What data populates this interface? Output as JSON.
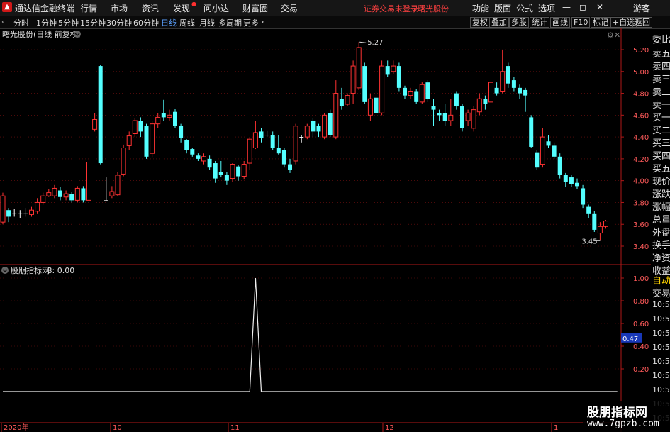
{
  "window": {
    "app_title": "通达信金融终端",
    "menus": [
      "行情",
      "市场",
      "资讯",
      "发现",
      "问小达",
      "财富圈",
      "交易"
    ],
    "notice": "证券交易未登录",
    "stock_name": "曙光股份",
    "right_menus": [
      "功能",
      "版面",
      "公式",
      "选项"
    ],
    "user": "游客"
  },
  "toolbar": {
    "periods": [
      "分时",
      "1分钟",
      "5分钟",
      "15分钟",
      "30分钟",
      "60分钟",
      "日线",
      "周线",
      "月线",
      "多周期",
      "更多"
    ],
    "active_period": "日线",
    "buttons": [
      "复权",
      "叠加",
      "多股",
      "统计",
      "画线",
      "F10",
      "标记",
      "+自选",
      "返回"
    ]
  },
  "chart": {
    "header": "曙光股份(日线 前复权)",
    "y_ticks": [
      "5.20",
      "5.00",
      "4.80",
      "4.60",
      "4.40",
      "4.20",
      "4.00",
      "3.80",
      "3.60",
      "3.40"
    ],
    "high_label": "5.27",
    "low_label": "3.45",
    "candles": [
      {
        "o": 3.62,
        "c": 3.86,
        "h": 3.89,
        "l": 3.6
      },
      {
        "o": 3.73,
        "c": 3.67,
        "h": 3.75,
        "l": 3.62
      },
      {
        "o": 3.7,
        "c": 3.7,
        "h": 3.74,
        "l": 3.67
      },
      {
        "o": 3.7,
        "c": 3.7,
        "h": 3.73,
        "l": 3.66
      },
      {
        "o": 3.7,
        "c": 3.7,
        "h": 3.75,
        "l": 3.67
      },
      {
        "o": 3.69,
        "c": 3.73,
        "h": 3.76,
        "l": 3.67
      },
      {
        "o": 3.72,
        "c": 3.8,
        "h": 3.84,
        "l": 3.7
      },
      {
        "o": 3.8,
        "c": 3.86,
        "h": 3.89,
        "l": 3.78
      },
      {
        "o": 3.86,
        "c": 3.89,
        "h": 3.92,
        "l": 3.85
      },
      {
        "o": 3.86,
        "c": 3.93,
        "h": 3.96,
        "l": 3.84
      },
      {
        "o": 3.91,
        "c": 3.85,
        "h": 3.94,
        "l": 3.82
      },
      {
        "o": 3.85,
        "c": 3.88,
        "h": 3.91,
        "l": 3.82
      },
      {
        "o": 3.88,
        "c": 3.82,
        "h": 3.9,
        "l": 3.8
      },
      {
        "o": 3.82,
        "c": 3.93,
        "h": 3.95,
        "l": 3.8
      },
      {
        "o": 3.93,
        "c": 3.82,
        "h": 3.95,
        "l": 3.8
      },
      {
        "o": 3.82,
        "c": 4.17,
        "h": 4.18,
        "l": 3.82
      },
      {
        "o": 4.47,
        "c": 4.56,
        "h": 4.62,
        "l": 4.45
      },
      {
        "o": 5.05,
        "c": 4.16,
        "h": 5.06,
        "l": 4.15
      },
      {
        "o": 3.82,
        "c": 3.82,
        "h": 4.03,
        "l": 3.81
      },
      {
        "o": 3.86,
        "c": 3.9,
        "h": 3.95,
        "l": 3.84
      },
      {
        "o": 3.87,
        "c": 4.05,
        "h": 4.08,
        "l": 3.86
      },
      {
        "o": 4.06,
        "c": 4.3,
        "h": 4.33,
        "l": 4.04
      },
      {
        "o": 4.32,
        "c": 4.41,
        "h": 4.45,
        "l": 4.28
      },
      {
        "o": 4.43,
        "c": 4.55,
        "h": 4.57,
        "l": 4.4
      },
      {
        "o": 4.55,
        "c": 4.45,
        "h": 4.58,
        "l": 4.4
      },
      {
        "o": 4.5,
        "c": 4.22,
        "h": 4.52,
        "l": 4.2
      },
      {
        "o": 4.25,
        "c": 4.52,
        "h": 4.55,
        "l": 4.21
      },
      {
        "o": 4.52,
        "c": 4.58,
        "h": 4.62,
        "l": 4.48
      },
      {
        "o": 4.62,
        "c": 4.58,
        "h": 4.74,
        "l": 4.55
      },
      {
        "o": 4.58,
        "c": 4.6,
        "h": 4.65,
        "l": 4.55
      },
      {
        "o": 4.63,
        "c": 4.5,
        "h": 4.66,
        "l": 4.48
      },
      {
        "o": 4.5,
        "c": 4.39,
        "h": 4.52,
        "l": 4.35
      },
      {
        "o": 4.37,
        "c": 4.28,
        "h": 4.38,
        "l": 4.25
      },
      {
        "o": 4.29,
        "c": 4.24,
        "h": 4.3,
        "l": 4.22
      },
      {
        "o": 4.23,
        "c": 4.2,
        "h": 4.25,
        "l": 4.18
      },
      {
        "o": 4.18,
        "c": 4.22,
        "h": 4.25,
        "l": 4.15
      },
      {
        "o": 4.2,
        "c": 4.12,
        "h": 4.23,
        "l": 4.1
      },
      {
        "o": 4.16,
        "c": 4.02,
        "h": 4.18,
        "l": 3.98
      },
      {
        "o": 4.08,
        "c": 4.05,
        "h": 4.18,
        "l": 4.03
      },
      {
        "o": 4.05,
        "c": 4.0,
        "h": 4.08,
        "l": 3.96
      },
      {
        "o": 4.02,
        "c": 4.15,
        "h": 4.16,
        "l": 3.99
      },
      {
        "o": 4.13,
        "c": 4.04,
        "h": 4.14,
        "l": 4.0
      },
      {
        "o": 4.04,
        "c": 4.15,
        "h": 4.18,
        "l": 4.01
      },
      {
        "o": 4.16,
        "c": 4.38,
        "h": 4.4,
        "l": 4.1
      },
      {
        "o": 4.3,
        "c": 4.44,
        "h": 4.55,
        "l": 4.29
      },
      {
        "o": 4.45,
        "c": 4.39,
        "h": 4.48,
        "l": 4.35
      },
      {
        "o": 4.42,
        "c": 4.42,
        "h": 4.46,
        "l": 4.4
      },
      {
        "o": 4.42,
        "c": 4.3,
        "h": 4.45,
        "l": 4.28
      },
      {
        "o": 4.3,
        "c": 4.25,
        "h": 4.42,
        "l": 4.24
      },
      {
        "o": 4.28,
        "c": 4.15,
        "h": 4.3,
        "l": 4.12
      },
      {
        "o": 4.15,
        "c": 4.1,
        "h": 4.2,
        "l": 4.07
      },
      {
        "o": 4.18,
        "c": 4.5,
        "h": 4.52,
        "l": 4.15
      },
      {
        "o": 4.4,
        "c": 4.4,
        "h": 4.42,
        "l": 4.35
      },
      {
        "o": 4.4,
        "c": 4.5,
        "h": 4.52,
        "l": 4.38
      },
      {
        "o": 4.55,
        "c": 4.45,
        "h": 4.57,
        "l": 4.4
      },
      {
        "o": 4.5,
        "c": 4.45,
        "h": 4.52,
        "l": 4.4
      },
      {
        "o": 4.4,
        "c": 4.6,
        "h": 4.62,
        "l": 4.38
      },
      {
        "o": 4.62,
        "c": 4.42,
        "h": 4.65,
        "l": 4.4
      },
      {
        "o": 4.4,
        "c": 4.8,
        "h": 4.92,
        "l": 4.38
      },
      {
        "o": 4.75,
        "c": 4.68,
        "h": 4.85,
        "l": 4.65
      },
      {
        "o": 4.7,
        "c": 4.78,
        "h": 4.8,
        "l": 4.68
      },
      {
        "o": 4.8,
        "c": 5.05,
        "h": 5.1,
        "l": 4.7
      },
      {
        "o": 4.85,
        "c": 5.22,
        "h": 5.27,
        "l": 4.83
      },
      {
        "o": 5.05,
        "c": 4.72,
        "h": 5.08,
        "l": 4.7
      },
      {
        "o": 4.6,
        "c": 4.75,
        "h": 4.8,
        "l": 4.55
      },
      {
        "o": 4.76,
        "c": 4.62,
        "h": 4.8,
        "l": 4.58
      },
      {
        "o": 4.62,
        "c": 5.05,
        "h": 5.1,
        "l": 4.6
      },
      {
        "o": 5.05,
        "c": 4.97,
        "h": 5.1,
        "l": 4.95
      },
      {
        "o": 5.0,
        "c": 5.05,
        "h": 5.1,
        "l": 4.98
      },
      {
        "o": 5.05,
        "c": 4.85,
        "h": 5.08,
        "l": 4.82
      },
      {
        "o": 4.85,
        "c": 4.78,
        "h": 4.87,
        "l": 4.75
      },
      {
        "o": 4.78,
        "c": 4.82,
        "h": 4.85,
        "l": 4.75
      },
      {
        "o": 4.82,
        "c": 4.72,
        "h": 4.84,
        "l": 4.7
      },
      {
        "o": 4.72,
        "c": 4.88,
        "h": 4.9,
        "l": 4.7
      },
      {
        "o": 4.9,
        "c": 4.75,
        "h": 4.92,
        "l": 4.72
      },
      {
        "o": 4.68,
        "c": 4.65,
        "h": 4.75,
        "l": 4.5
      },
      {
        "o": 4.62,
        "c": 4.6,
        "h": 4.65,
        "l": 4.55
      },
      {
        "o": 4.62,
        "c": 4.55,
        "h": 4.7,
        "l": 4.5
      },
      {
        "o": 4.55,
        "c": 4.6,
        "h": 4.75,
        "l": 4.5
      },
      {
        "o": 4.8,
        "c": 4.68,
        "h": 4.82,
        "l": 4.65
      },
      {
        "o": 4.68,
        "c": 4.48,
        "h": 4.7,
        "l": 4.45
      },
      {
        "o": 4.55,
        "c": 4.62,
        "h": 4.65,
        "l": 4.5
      },
      {
        "o": 4.48,
        "c": 4.65,
        "h": 4.68,
        "l": 4.45
      },
      {
        "o": 4.63,
        "c": 4.75,
        "h": 4.8,
        "l": 4.6
      },
      {
        "o": 4.75,
        "c": 4.7,
        "h": 4.78,
        "l": 4.65
      },
      {
        "o": 4.72,
        "c": 4.9,
        "h": 4.95,
        "l": 4.7
      },
      {
        "o": 4.85,
        "c": 4.8,
        "h": 4.9,
        "l": 4.78
      },
      {
        "o": 4.82,
        "c": 5.0,
        "h": 5.2,
        "l": 4.8
      },
      {
        "o": 5.05,
        "c": 4.89,
        "h": 5.08,
        "l": 4.85
      },
      {
        "o": 4.92,
        "c": 4.85,
        "h": 4.95,
        "l": 4.82
      },
      {
        "o": 4.85,
        "c": 4.8,
        "h": 4.88,
        "l": 4.75
      },
      {
        "o": 4.83,
        "c": 4.78,
        "h": 4.85,
        "l": 4.63
      },
      {
        "o": 4.58,
        "c": 4.31,
        "h": 4.6,
        "l": 4.3
      },
      {
        "o": 4.26,
        "c": 4.12,
        "h": 4.28,
        "l": 4.1
      },
      {
        "o": 4.15,
        "c": 4.4,
        "h": 4.48,
        "l": 4.12
      },
      {
        "o": 4.36,
        "c": 4.32,
        "h": 4.42,
        "l": 4.3
      },
      {
        "o": 4.32,
        "c": 4.22,
        "h": 4.35,
        "l": 4.2
      },
      {
        "o": 4.22,
        "c": 4.05,
        "h": 4.25,
        "l": 4.02
      },
      {
        "o": 4.05,
        "c": 3.99,
        "h": 4.07,
        "l": 3.94
      },
      {
        "o": 4.03,
        "c": 3.97,
        "h": 4.05,
        "l": 3.94
      },
      {
        "o": 3.98,
        "c": 3.95,
        "h": 4.02,
        "l": 3.92
      },
      {
        "o": 3.93,
        "c": 3.78,
        "h": 3.96,
        "l": 3.75
      },
      {
        "o": 3.76,
        "c": 3.7,
        "h": 3.78,
        "l": 3.66
      },
      {
        "o": 3.7,
        "c": 3.55,
        "h": 3.72,
        "l": 3.53
      },
      {
        "o": 3.52,
        "c": 3.58,
        "h": 3.62,
        "l": 3.45
      },
      {
        "o": 3.58,
        "c": 3.63,
        "h": 3.64,
        "l": 3.56
      }
    ]
  },
  "indicator": {
    "header": "股朋指标网",
    "value_label": "B: 0.00",
    "y_ticks": [
      "1.00",
      "0.80",
      "0.60",
      "0.47",
      "0.40",
      "0.20"
    ],
    "values": [
      0,
      0,
      0,
      0,
      0,
      0,
      0,
      0,
      0,
      0,
      0,
      0,
      0,
      0,
      0,
      0,
      0,
      0,
      0,
      0,
      0,
      0,
      0,
      0,
      0,
      0,
      0,
      0,
      0,
      0,
      0,
      0,
      0,
      0,
      0,
      0,
      0,
      0,
      0,
      0,
      0,
      0,
      0,
      0,
      1,
      0,
      0,
      0,
      0,
      0,
      0,
      0,
      0,
      0,
      0,
      0,
      0,
      0,
      0,
      0,
      0,
      0,
      0,
      0,
      0,
      0,
      0,
      0,
      0,
      0,
      0,
      0,
      0,
      0,
      0,
      0,
      0,
      0,
      0,
      0,
      0,
      0,
      0,
      0,
      0,
      0,
      0,
      0,
      0,
      0,
      0,
      0,
      0,
      0,
      0,
      0,
      0,
      0,
      0,
      0,
      0,
      0,
      0,
      0,
      0,
      0,
      0,
      0
    ]
  },
  "x_axis": [
    "2020年",
    "10",
    "11",
    "12",
    "1"
  ],
  "right_panel": {
    "items": [
      "委比",
      "卖五",
      "卖四",
      "卖三",
      "卖二",
      "卖一",
      "买一",
      "买二",
      "买三",
      "买四",
      "买五",
      "现价",
      "涨跌",
      "涨幅",
      "总量",
      "外盘",
      "换手",
      "净资",
      "收益"
    ],
    "auto_trade": "自动",
    "trade": "交易",
    "times": [
      "10:51",
      "10:51",
      "10:51",
      "10:52",
      "10:52",
      "10:52",
      "10:52",
      "10:52",
      "10:52"
    ]
  },
  "watermark": {
    "line1": "股朋指标网",
    "line2": "www.7gpzb.com"
  },
  "colors": {
    "up": "#ff3232",
    "down": "#54ffff",
    "grid": "#7a1010",
    "axis": "#b01818"
  }
}
